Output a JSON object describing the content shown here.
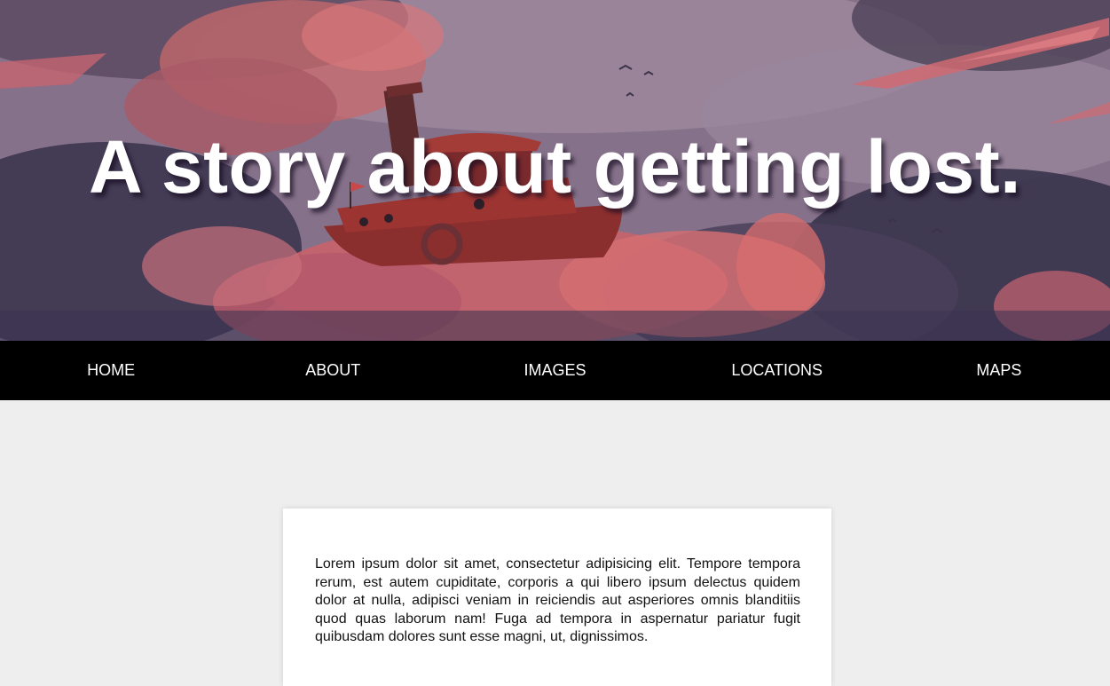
{
  "hero": {
    "title": "A story about getting lost.",
    "image": "illustration of a red steamboat floating among pink and purple clouds",
    "colors": {
      "sky": "#8d7a93",
      "cloud_pink": "#d96a6a",
      "boat_red": "#8b2e2e",
      "dark_cloud": "#3f3a55"
    }
  },
  "nav": {
    "items": [
      {
        "label": "HOME"
      },
      {
        "label": "ABOUT"
      },
      {
        "label": "IMAGES"
      },
      {
        "label": "LOCATIONS"
      },
      {
        "label": "MAPS"
      }
    ],
    "background": "#000000",
    "text_color": "#ffffff"
  },
  "content": {
    "paragraph": "Lorem ipsum dolor sit amet, consectetur adipisicing elit. Tempore tempora rerum, est autem cupiditate, corporis a qui libero ipsum delectus quidem dolor at nulla, adipisci veniam in reiciendis aut asperiores omnis blanditiis quod quas laborum nam! Fuga ad tempora in aspernatur pariatur fugit quibusdam dolores sunt esse magni, ut, dignissimos."
  },
  "page": {
    "background": "#eeeeee",
    "card_background": "#ffffff"
  }
}
